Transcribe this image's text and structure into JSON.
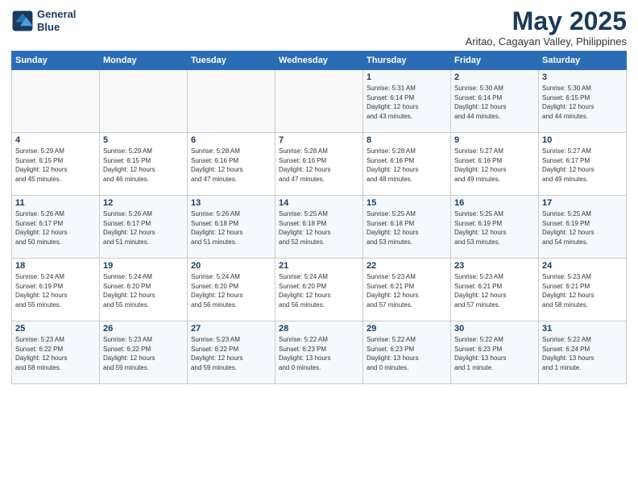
{
  "app": {
    "logo_line1": "General",
    "logo_line2": "Blue"
  },
  "header": {
    "month_year": "May 2025",
    "location": "Aritao, Cagayan Valley, Philippines"
  },
  "days_of_week": [
    "Sunday",
    "Monday",
    "Tuesday",
    "Wednesday",
    "Thursday",
    "Friday",
    "Saturday"
  ],
  "weeks": [
    [
      {
        "day": "",
        "info": ""
      },
      {
        "day": "",
        "info": ""
      },
      {
        "day": "",
        "info": ""
      },
      {
        "day": "",
        "info": ""
      },
      {
        "day": "1",
        "info": "Sunrise: 5:31 AM\nSunset: 6:14 PM\nDaylight: 12 hours\nand 43 minutes."
      },
      {
        "day": "2",
        "info": "Sunrise: 5:30 AM\nSunset: 6:14 PM\nDaylight: 12 hours\nand 44 minutes."
      },
      {
        "day": "3",
        "info": "Sunrise: 5:30 AM\nSunset: 6:15 PM\nDaylight: 12 hours\nand 44 minutes."
      }
    ],
    [
      {
        "day": "4",
        "info": "Sunrise: 5:29 AM\nSunset: 6:15 PM\nDaylight: 12 hours\nand 45 minutes."
      },
      {
        "day": "5",
        "info": "Sunrise: 5:29 AM\nSunset: 6:15 PM\nDaylight: 12 hours\nand 46 minutes."
      },
      {
        "day": "6",
        "info": "Sunrise: 5:28 AM\nSunset: 6:16 PM\nDaylight: 12 hours\nand 47 minutes."
      },
      {
        "day": "7",
        "info": "Sunrise: 5:28 AM\nSunset: 6:16 PM\nDaylight: 12 hours\nand 47 minutes."
      },
      {
        "day": "8",
        "info": "Sunrise: 5:28 AM\nSunset: 6:16 PM\nDaylight: 12 hours\nand 48 minutes."
      },
      {
        "day": "9",
        "info": "Sunrise: 5:27 AM\nSunset: 6:16 PM\nDaylight: 12 hours\nand 49 minutes."
      },
      {
        "day": "10",
        "info": "Sunrise: 5:27 AM\nSunset: 6:17 PM\nDaylight: 12 hours\nand 49 minutes."
      }
    ],
    [
      {
        "day": "11",
        "info": "Sunrise: 5:26 AM\nSunset: 6:17 PM\nDaylight: 12 hours\nand 50 minutes."
      },
      {
        "day": "12",
        "info": "Sunrise: 5:26 AM\nSunset: 6:17 PM\nDaylight: 12 hours\nand 51 minutes."
      },
      {
        "day": "13",
        "info": "Sunrise: 5:26 AM\nSunset: 6:18 PM\nDaylight: 12 hours\nand 51 minutes."
      },
      {
        "day": "14",
        "info": "Sunrise: 5:25 AM\nSunset: 6:18 PM\nDaylight: 12 hours\nand 52 minutes."
      },
      {
        "day": "15",
        "info": "Sunrise: 5:25 AM\nSunset: 6:18 PM\nDaylight: 12 hours\nand 53 minutes."
      },
      {
        "day": "16",
        "info": "Sunrise: 5:25 AM\nSunset: 6:19 PM\nDaylight: 12 hours\nand 53 minutes."
      },
      {
        "day": "17",
        "info": "Sunrise: 5:25 AM\nSunset: 6:19 PM\nDaylight: 12 hours\nand 54 minutes."
      }
    ],
    [
      {
        "day": "18",
        "info": "Sunrise: 5:24 AM\nSunset: 6:19 PM\nDaylight: 12 hours\nand 55 minutes."
      },
      {
        "day": "19",
        "info": "Sunrise: 5:24 AM\nSunset: 6:20 PM\nDaylight: 12 hours\nand 55 minutes."
      },
      {
        "day": "20",
        "info": "Sunrise: 5:24 AM\nSunset: 6:20 PM\nDaylight: 12 hours\nand 56 minutes."
      },
      {
        "day": "21",
        "info": "Sunrise: 5:24 AM\nSunset: 6:20 PM\nDaylight: 12 hours\nand 56 minutes."
      },
      {
        "day": "22",
        "info": "Sunrise: 5:23 AM\nSunset: 6:21 PM\nDaylight: 12 hours\nand 57 minutes."
      },
      {
        "day": "23",
        "info": "Sunrise: 5:23 AM\nSunset: 6:21 PM\nDaylight: 12 hours\nand 57 minutes."
      },
      {
        "day": "24",
        "info": "Sunrise: 5:23 AM\nSunset: 6:21 PM\nDaylight: 12 hours\nand 58 minutes."
      }
    ],
    [
      {
        "day": "25",
        "info": "Sunrise: 5:23 AM\nSunset: 6:22 PM\nDaylight: 12 hours\nand 58 minutes."
      },
      {
        "day": "26",
        "info": "Sunrise: 5:23 AM\nSunset: 6:22 PM\nDaylight: 12 hours\nand 59 minutes."
      },
      {
        "day": "27",
        "info": "Sunrise: 5:23 AM\nSunset: 6:22 PM\nDaylight: 12 hours\nand 59 minutes."
      },
      {
        "day": "28",
        "info": "Sunrise: 5:22 AM\nSunset: 6:23 PM\nDaylight: 13 hours\nand 0 minutes."
      },
      {
        "day": "29",
        "info": "Sunrise: 5:22 AM\nSunset: 6:23 PM\nDaylight: 13 hours\nand 0 minutes."
      },
      {
        "day": "30",
        "info": "Sunrise: 5:22 AM\nSunset: 6:23 PM\nDaylight: 13 hours\nand 1 minute."
      },
      {
        "day": "31",
        "info": "Sunrise: 5:22 AM\nSunset: 6:24 PM\nDaylight: 13 hours\nand 1 minute."
      }
    ]
  ]
}
